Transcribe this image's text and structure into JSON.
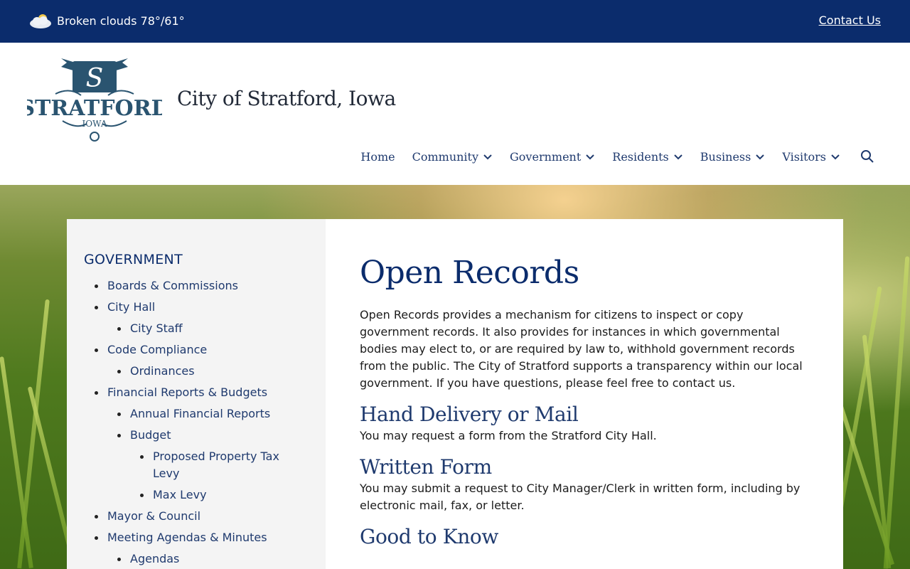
{
  "topbar": {
    "weather_icon": "cloud-sun-icon",
    "weather_text": "Broken clouds 78°/61°",
    "contact_label": "Contact Us"
  },
  "header": {
    "logo_text": "STRATFORD",
    "logo_subtext": "IOWA",
    "site_title": "City of Stratford, Iowa"
  },
  "nav": {
    "items": [
      {
        "label": "Home",
        "has_dropdown": false
      },
      {
        "label": "Community",
        "has_dropdown": true
      },
      {
        "label": "Government",
        "has_dropdown": true
      },
      {
        "label": "Residents",
        "has_dropdown": true
      },
      {
        "label": "Business",
        "has_dropdown": true
      },
      {
        "label": "Visitors",
        "has_dropdown": true
      }
    ],
    "search_icon": "search-icon"
  },
  "sidebar": {
    "title": "GOVERNMENT",
    "items": [
      {
        "label": "Boards & Commissions",
        "level": 1
      },
      {
        "label": "City Hall",
        "level": 1
      },
      {
        "label": "City Staff",
        "level": 2
      },
      {
        "label": "Code Compliance",
        "level": 1
      },
      {
        "label": "Ordinances",
        "level": 2
      },
      {
        "label": "Financial Reports & Budgets",
        "level": 1
      },
      {
        "label": "Annual Financial Reports",
        "level": 2
      },
      {
        "label": "Budget",
        "level": 2
      },
      {
        "label": "Proposed Property Tax Levy",
        "level": 3
      },
      {
        "label": "Max Levy",
        "level": 3
      },
      {
        "label": "Mayor & Council",
        "level": 1
      },
      {
        "label": "Meeting Agendas & Minutes",
        "level": 1
      },
      {
        "label": "Agendas",
        "level": 2
      }
    ]
  },
  "content": {
    "title": "Open Records",
    "intro": "Open Records provides a mechanism for citizens to inspect or copy government records. It also provides for instances in which governmental bodies may elect to, or are required by law to, withhold government records from the public. The City of Stratford supports a transparency within our local government.  If you have questions, please feel free to contact us.",
    "sections": [
      {
        "heading": "Hand Delivery or Mail",
        "text": "You may request a form from the Stratford City Hall."
      },
      {
        "heading": "Written Form",
        "text": "You may submit a request to City Manager/Clerk in written form, including by electronic mail, fax, or letter."
      },
      {
        "heading": "Good to Know",
        "text": ""
      }
    ]
  },
  "colors": {
    "topbar_bg": "#0b2c6c",
    "nav_text": "#1f3a6e",
    "heading": "#0b2c6c",
    "sidebar_bg": "#f4f4f4"
  }
}
